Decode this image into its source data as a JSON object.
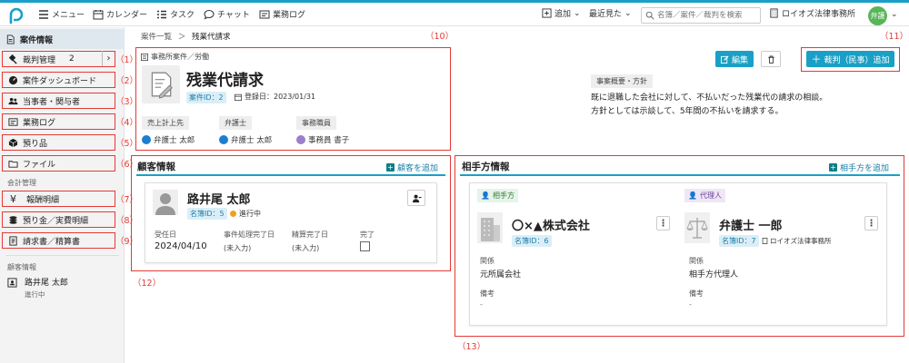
{
  "topbar": {
    "nav": [
      {
        "label": "メニュー",
        "icon": "hamburger-icon"
      },
      {
        "label": "カレンダー",
        "icon": "calendar-icon"
      },
      {
        "label": "タスク",
        "icon": "task-list-icon"
      },
      {
        "label": "チャット",
        "icon": "chat-icon"
      },
      {
        "label": "業務ログ",
        "icon": "work-log-icon"
      }
    ],
    "add_label": "追加",
    "recent_label": "最近見た",
    "search_placeholder": "名簿／案件／裁判を検索",
    "office_name": "ロイオズ法律事務所",
    "avatar_label": "弁護"
  },
  "sidebar": {
    "items": [
      {
        "label": "案件情報",
        "icon": "document-icon"
      },
      {
        "label": "裁判管理",
        "count": "2",
        "icon": "gavel-icon",
        "num": "（1）"
      },
      {
        "label": "案件ダッシュボード",
        "icon": "dashboard-icon",
        "num": "（2）"
      },
      {
        "label": "当事者・関与者",
        "icon": "people-icon",
        "num": "（3）"
      },
      {
        "label": "業務ログ",
        "icon": "work-log-icon",
        "num": "（4）"
      },
      {
        "label": "預り品",
        "icon": "box-icon",
        "num": "（5）"
      },
      {
        "label": "ファイル",
        "icon": "folder-icon",
        "num": "（6）"
      },
      {
        "label": "報酬明細",
        "icon": "yen-icon",
        "num": "（7）"
      },
      {
        "label": "預り金／実費明細",
        "icon": "coins-icon",
        "num": "（8）"
      },
      {
        "label": "請求書／精算書",
        "icon": "invoice-icon",
        "num": "（9）"
      }
    ],
    "accounting_heading": "会計管理",
    "client_heading": "顧客情報",
    "client_name": "路井尾 太郎",
    "client_status": "進行中"
  },
  "breadcrumb": {
    "parent": "案件一覧",
    "separator": "＞",
    "current": "残業代請求"
  },
  "annotations": {
    "n10": "（10）",
    "n11": "（11）",
    "n12": "（12）",
    "n13": "（13）"
  },
  "case": {
    "category": "事務所案件／労働",
    "title": "残業代請求",
    "case_id": "案件ID：2",
    "registered": "登録日：2023/01/31",
    "roles": [
      {
        "label": "売上計上先",
        "person": "弁護士 太郎",
        "color": "#1a7fd1"
      },
      {
        "label": "弁護士",
        "person": "弁護士 太郎",
        "color": "#1a7fd1"
      },
      {
        "label": "事務職員",
        "person": "事務員 書子",
        "color": "#9c7fc9"
      }
    ],
    "summary_label": "事案概要・方針",
    "summary_text": [
      "既に退職した会社に対して、不払いだった残業代の請求の相談。",
      "方針としては示談して、5年間の不払いを請求する。"
    ]
  },
  "actions": {
    "edit": "編集",
    "add_trial": "裁判（民事）追加"
  },
  "client_section": {
    "title": "顧客情報",
    "add_label": "顧客を追加",
    "name": "路井尾 太郎",
    "meibo_id": "名簿ID：5",
    "status": "進行中",
    "fields": [
      {
        "label": "受任日",
        "value": "2024/04/10"
      },
      {
        "label": "事件処理完了日",
        "value": "(未入力)"
      },
      {
        "label": "精算完了日",
        "value": "(未入力)"
      },
      {
        "label": "完了",
        "value": ""
      }
    ]
  },
  "opponent_section": {
    "title": "相手方情報",
    "add_label": "相手方を追加",
    "parties": [
      {
        "role": "相手方",
        "name": "〇×▲株式会社",
        "meibo_id": "名簿ID：6",
        "office": "",
        "relation_label": "関係",
        "relation": "元所属会社",
        "note_label": "備考",
        "note": "-"
      },
      {
        "role": "代理人",
        "name": "弁護士 一郎",
        "meibo_id": "名簿ID：7",
        "office": "ロイオズ法律事務所",
        "relation_label": "関係",
        "relation": "相手方代理人",
        "note_label": "備考",
        "note": "-"
      }
    ]
  },
  "colors": {
    "accent": "#1aa0c6",
    "annotation": "#e53935",
    "status_dot": "#f0a020"
  }
}
